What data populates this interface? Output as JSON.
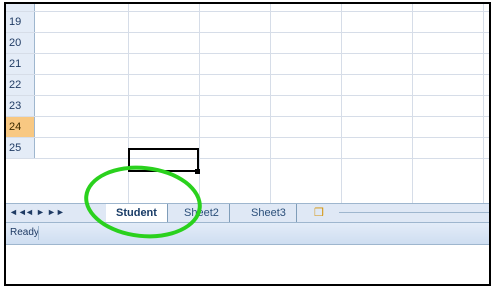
{
  "rows": [
    {
      "label": "19",
      "active": false
    },
    {
      "label": "20",
      "active": false
    },
    {
      "label": "21",
      "active": false
    },
    {
      "label": "22",
      "active": false
    },
    {
      "label": "23",
      "active": false
    },
    {
      "label": "24",
      "active": true
    },
    {
      "label": "25",
      "active": false
    }
  ],
  "tabs": {
    "nav_glyphs": [
      "◄◄",
      "◄",
      "►",
      "►►"
    ],
    "student": "Student",
    "sheet2": "Sheet2",
    "sheet3": "Sheet3",
    "insert_icon": "insert-sheet-icon"
  },
  "status": {
    "text": "Ready"
  },
  "colors": {
    "highlight_ellipse": "#2ad11d",
    "active_row": "#f8c882"
  }
}
